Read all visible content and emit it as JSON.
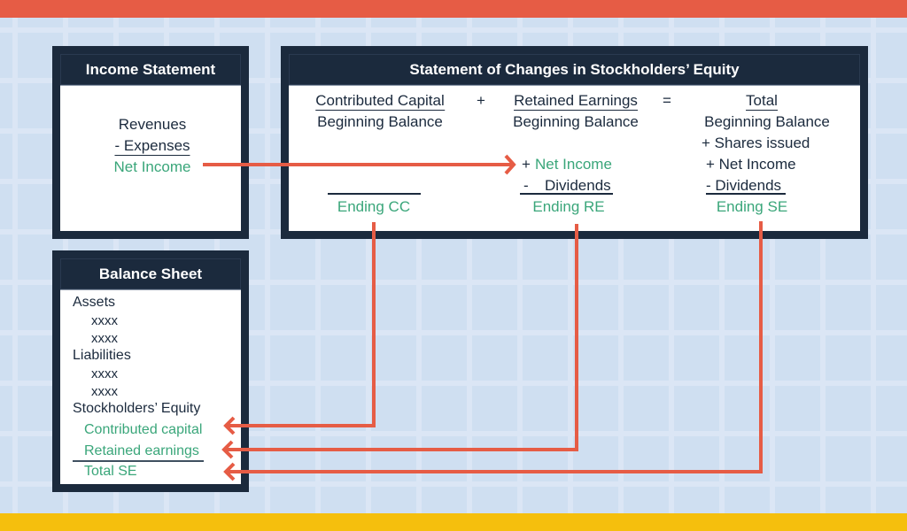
{
  "colors": {
    "top_bar": "#e65c45",
    "bottom_bar": "#f5bf0d",
    "background": "#cfdff1",
    "panel": "#1b2a3d",
    "highlight_text": "#3aa67a",
    "arrow": "#e65c45"
  },
  "income_statement": {
    "title": "Income Statement",
    "lines": [
      "Revenues",
      "- Expenses",
      "Net Income"
    ]
  },
  "changes_in_equity": {
    "title": "Statement of Changes in Stockholders’ Equity",
    "operators": [
      "+",
      "="
    ],
    "contributed_capital": {
      "heading": "Contributed Capital",
      "beginning": "Beginning Balance",
      "ending": "Ending CC"
    },
    "retained_earnings": {
      "heading": "Retained Earnings",
      "beginning": "Beginning Balance",
      "plus_net_income_sign": "+",
      "net_income": "Net Income",
      "minus_dividends_sign": "-",
      "dividends": "Dividends",
      "ending": "Ending RE"
    },
    "total": {
      "heading": "Total",
      "beginning": "Beginning Balance",
      "shares_issued": "+ Shares issued",
      "net_income": "+ Net Income",
      "dividends": "- Dividends",
      "ending": "Ending SE"
    }
  },
  "balance_sheet": {
    "title": "Balance Sheet",
    "assets_label": "Assets",
    "assets_items": [
      "xxxx",
      "xxxx"
    ],
    "liabilities_label": "Liabilities",
    "liabilities_items": [
      "xxxx",
      "xxxx"
    ],
    "equity_label": "Stockholders’ Equity",
    "contributed_capital": "Contributed capital",
    "retained_earnings": "Retained earnings",
    "total_se": "Total SE"
  },
  "flows": [
    {
      "from": "Net Income (Income Statement)",
      "to": "Net Income (Retained Earnings)"
    },
    {
      "from": "Ending CC",
      "to": "Contributed capital"
    },
    {
      "from": "Ending RE",
      "to": "Retained earnings"
    },
    {
      "from": "Ending SE",
      "to": "Total SE"
    }
  ]
}
